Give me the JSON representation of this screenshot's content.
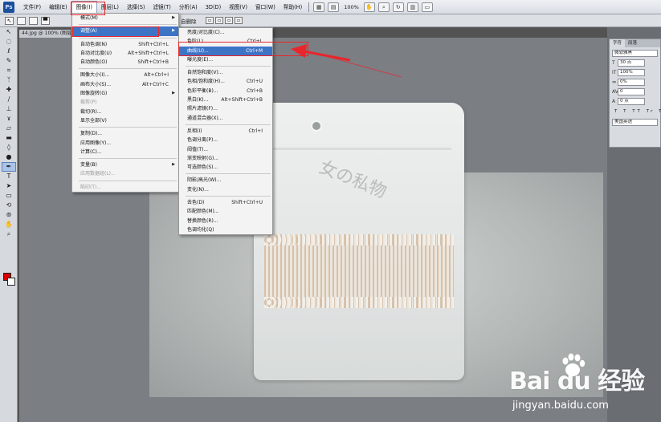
{
  "app": {
    "logo": "Ps"
  },
  "menubar": {
    "items": [
      "文件(F)",
      "编辑(E)",
      "图像(I)",
      "图层(L)",
      "选择(S)",
      "滤镜(T)",
      "分析(A)",
      "3D(D)",
      "视图(V)",
      "窗口(W)",
      "帮助(H)"
    ],
    "zoom": "100%"
  },
  "options_bar": {
    "hint": "自删除"
  },
  "document": {
    "tab_title": "44.jpg @ 100% (图层"
  },
  "image_menu": {
    "items": [
      {
        "label": "模式(M)",
        "submenu": true
      },
      {
        "label": "调整(A)",
        "submenu": true,
        "highlighted": true
      },
      {
        "label": "自动色调(N)",
        "shortcut": "Shift+Ctrl+L"
      },
      {
        "label": "自动对比度(U)",
        "shortcut": "Alt+Shift+Ctrl+L"
      },
      {
        "label": "自动颜色(O)",
        "shortcut": "Shift+Ctrl+B"
      },
      {
        "label": "图像大小(I)...",
        "shortcut": "Alt+Ctrl+I"
      },
      {
        "label": "画布大小(S)...",
        "shortcut": "Alt+Ctrl+C"
      },
      {
        "label": "图像旋转(G)",
        "submenu": true
      },
      {
        "label": "裁剪(P)",
        "disabled": true
      },
      {
        "label": "裁切(R)..."
      },
      {
        "label": "显示全部(V)"
      },
      {
        "label": "复制(D)..."
      },
      {
        "label": "应用图像(Y)..."
      },
      {
        "label": "计算(C)..."
      },
      {
        "label": "变量(B)",
        "submenu": true
      },
      {
        "label": "应用数据组(L)...",
        "disabled": true
      },
      {
        "label": "陷印(T)...",
        "disabled": true
      }
    ]
  },
  "adjust_menu": {
    "items": [
      {
        "label": "亮度/对比度(C)..."
      },
      {
        "label": "色阶(L)...",
        "shortcut": "Ctrl+L"
      },
      {
        "label": "曲线(U)...",
        "shortcut": "Ctrl+M",
        "highlighted": true
      },
      {
        "label": "曝光度(E)..."
      },
      {
        "label": "自然饱和度(V)..."
      },
      {
        "label": "色相/饱和度(H)...",
        "shortcut": "Ctrl+U"
      },
      {
        "label": "色彩平衡(B)...",
        "shortcut": "Ctrl+B"
      },
      {
        "label": "黑白(K)...",
        "shortcut": "Alt+Shift+Ctrl+B"
      },
      {
        "label": "照片滤镜(F)..."
      },
      {
        "label": "通道混合器(X)..."
      },
      {
        "label": "反相(I)",
        "shortcut": "Ctrl+I"
      },
      {
        "label": "色调分离(P)..."
      },
      {
        "label": "阈值(T)..."
      },
      {
        "label": "渐变映射(G)..."
      },
      {
        "label": "可选颜色(S)..."
      },
      {
        "label": "阴影/高光(W)..."
      },
      {
        "label": "变化(N)..."
      },
      {
        "label": "去色(D)",
        "shortcut": "Shift+Ctrl+U"
      },
      {
        "label": "匹配颜色(M)..."
      },
      {
        "label": "替换颜色(R)..."
      },
      {
        "label": "色调均化(Q)"
      }
    ]
  },
  "character_panel": {
    "tabs": [
      "字符",
      "段落"
    ],
    "font": "微软雅黑",
    "size": "30 点",
    "vertical_scale": "100%",
    "tracking": "0%",
    "kerning": "0",
    "baseline": "0 点",
    "style_buttons": "T T TT Tr T",
    "language": "美国英语"
  },
  "colors": {
    "foreground": "#d40000",
    "background": "#ffffff",
    "highlight": "#3e74c6",
    "annotation": "#e8262b"
  },
  "photo": {
    "print_text": "女の私物"
  },
  "watermark": {
    "logo": "Bai du 经验",
    "url": "jingyan.baidu.com"
  }
}
